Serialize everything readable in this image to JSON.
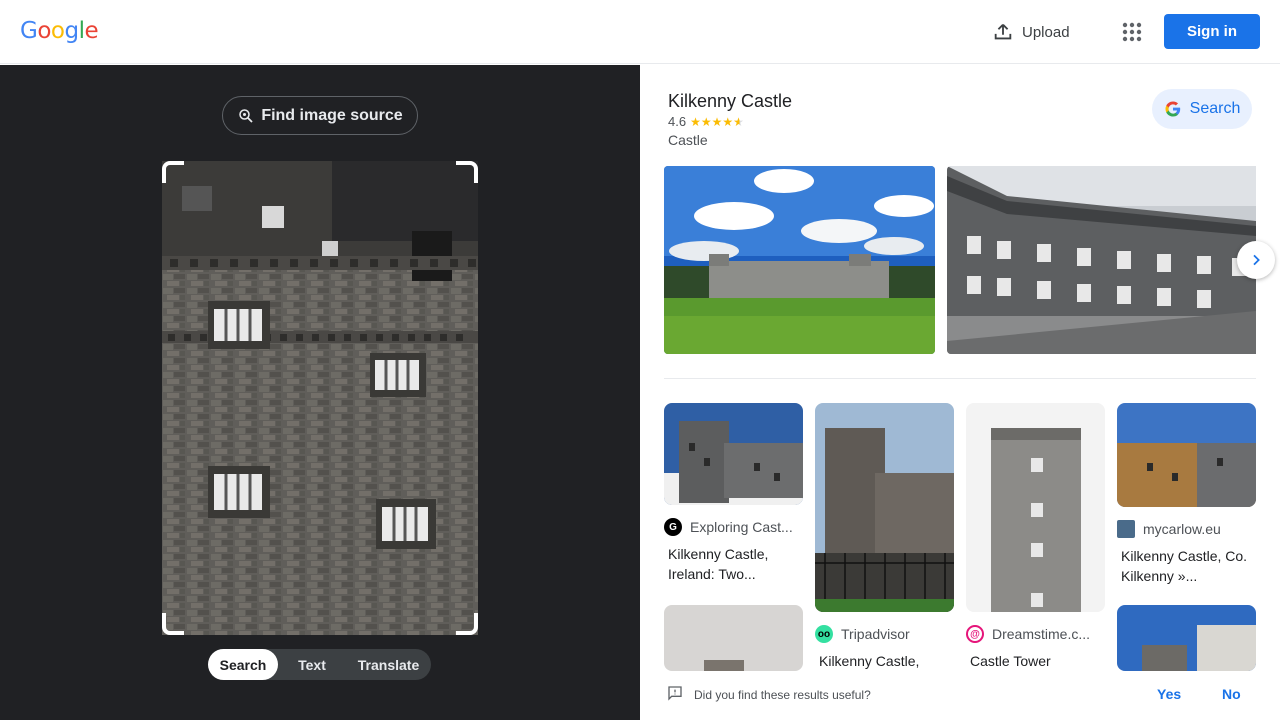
{
  "header": {
    "logo_letters": [
      "G",
      "o",
      "o",
      "g",
      "l",
      "e"
    ],
    "logo_colors": [
      "#4285f4",
      "#ea4335",
      "#fbbc05",
      "#4285f4",
      "#34a853",
      "#ea4335"
    ],
    "upload_label": "Upload",
    "signin_label": "Sign in"
  },
  "lens": {
    "find_source_label": "Find image source",
    "modes": [
      "Search",
      "Text",
      "Translate"
    ],
    "active_mode": "Search"
  },
  "knowledge_panel": {
    "title": "Kilkenny Castle",
    "rating": "4.6",
    "rating_stars": 4.6,
    "subtitle": "Castle",
    "search_label": "Search"
  },
  "results": [
    {
      "source": "Exploring Cast...",
      "title": "Kilkenny Castle, Ireland: Two...",
      "favicon": "G",
      "favicon_color": "#000000"
    },
    {
      "source": "Tripadvisor",
      "title": "Kilkenny Castle,",
      "favicon": "tripadvisor-owl",
      "favicon_color": "#34e0a1"
    },
    {
      "source": "Dreamstime.c...",
      "title": "Castle Tower",
      "favicon": "dreamstime-swirl",
      "favicon_color": "#e5157a"
    },
    {
      "source": "mycarlow.eu",
      "title": "Kilkenny Castle, Co. Kilkenny »...",
      "favicon": "mycarlow",
      "favicon_color": "#4a6b8a"
    }
  ],
  "feedback": {
    "question": "Did you find these results useful?",
    "yes": "Yes",
    "no": "No"
  },
  "colors": {
    "accent": "#1a73e8",
    "dark_panel": "#202124",
    "star": "#fbbc04"
  }
}
